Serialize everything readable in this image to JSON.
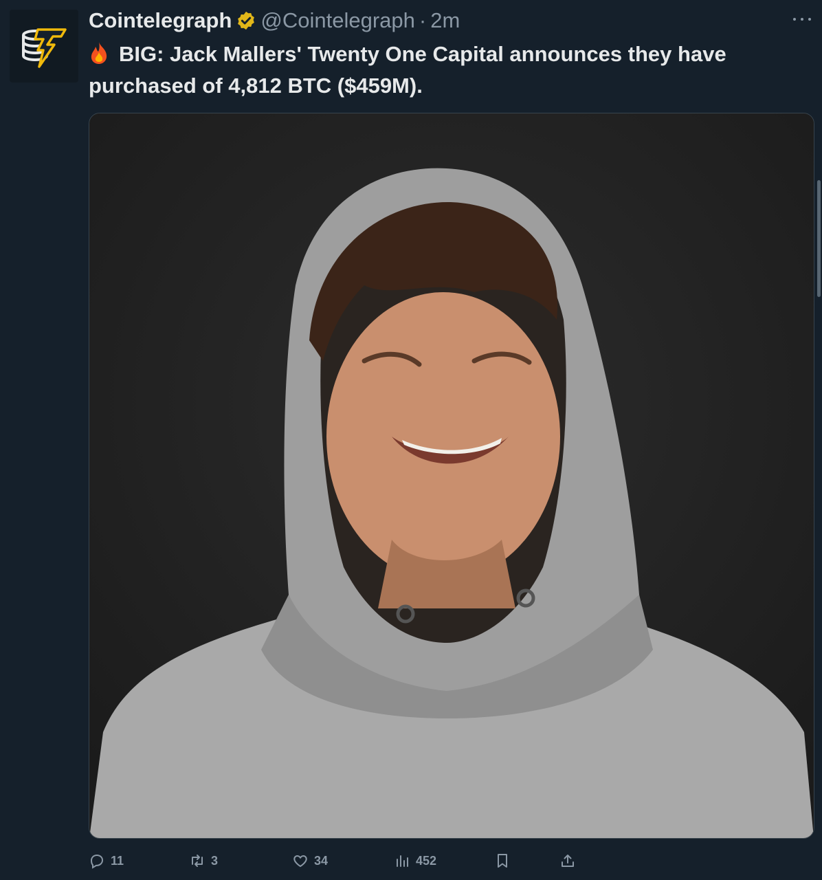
{
  "tweet": {
    "author_name": "Cointelegraph",
    "handle": "@Cointelegraph",
    "separator": "·",
    "time": "2m",
    "text": "BIG: Jack Mallers' Twenty One Capital announces they have purchased of 4,812 BTC ($459M).",
    "media_description": "Smiling man wearing a grey hoodie against a dark background"
  },
  "actions": {
    "replies": "11",
    "retweets": "3",
    "likes": "34",
    "views": "452"
  },
  "colors": {
    "background": "#15202b",
    "text": "#e7e9ea",
    "muted": "#8b98a5",
    "verified_badge": "#e2b719",
    "logo_gold": "#f0b90b"
  },
  "icons": [
    "cointelegraph-logo-icon",
    "verified-badge-icon",
    "more-icon",
    "fire-icon",
    "reply-icon",
    "retweet-icon",
    "like-icon",
    "views-icon",
    "bookmark-icon",
    "share-icon"
  ]
}
